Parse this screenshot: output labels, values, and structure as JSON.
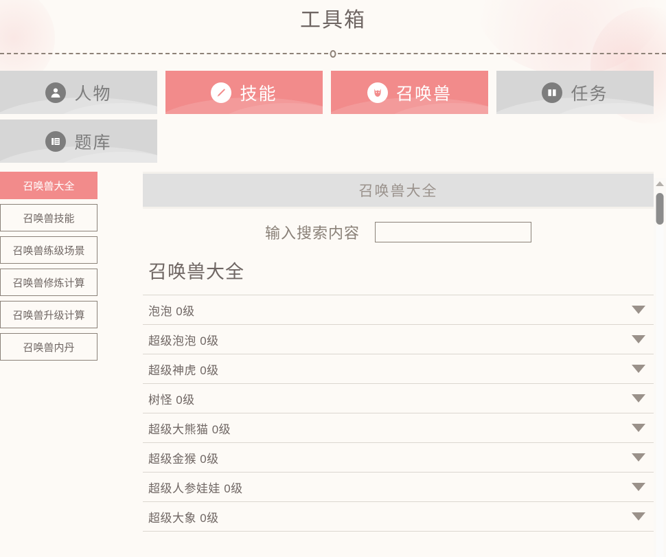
{
  "header": {
    "title": "工具箱"
  },
  "tabs": [
    {
      "label": "人物",
      "icon": "person-icon",
      "active": false
    },
    {
      "label": "技能",
      "icon": "brush-icon",
      "active": true
    },
    {
      "label": "召唤兽",
      "icon": "pet-icon",
      "active": true
    },
    {
      "label": "任务",
      "icon": "book-icon",
      "active": false
    },
    {
      "label": "题库",
      "icon": "quiz-icon",
      "active": false
    }
  ],
  "sidebar": {
    "items": [
      {
        "label": "召唤兽大全",
        "active": true
      },
      {
        "label": "召唤兽技能",
        "active": false
      },
      {
        "label": "召唤兽练级场景",
        "active": false
      },
      {
        "label": "召唤兽修炼计算",
        "active": false
      },
      {
        "label": "召唤兽升级计算",
        "active": false
      },
      {
        "label": "召唤兽内丹",
        "active": false
      }
    ]
  },
  "main": {
    "section_bar_title": "召唤兽大全",
    "search": {
      "label": "输入搜索内容",
      "value": "",
      "placeholder": ""
    },
    "list_title": "召唤兽大全",
    "list_items": [
      {
        "label": "泡泡 0级"
      },
      {
        "label": "超级泡泡 0级"
      },
      {
        "label": "超级神虎 0级"
      },
      {
        "label": "树怪 0级"
      },
      {
        "label": "超级大熊猫 0级"
      },
      {
        "label": "超级金猴 0级"
      },
      {
        "label": "超级人参娃娃 0级"
      },
      {
        "label": "超级大象 0级"
      }
    ]
  },
  "colors": {
    "accent_pink": "#f28b8b",
    "tab_gray": "#d6d6d6",
    "background": "#fdfaf6",
    "text": "#6f6663"
  }
}
